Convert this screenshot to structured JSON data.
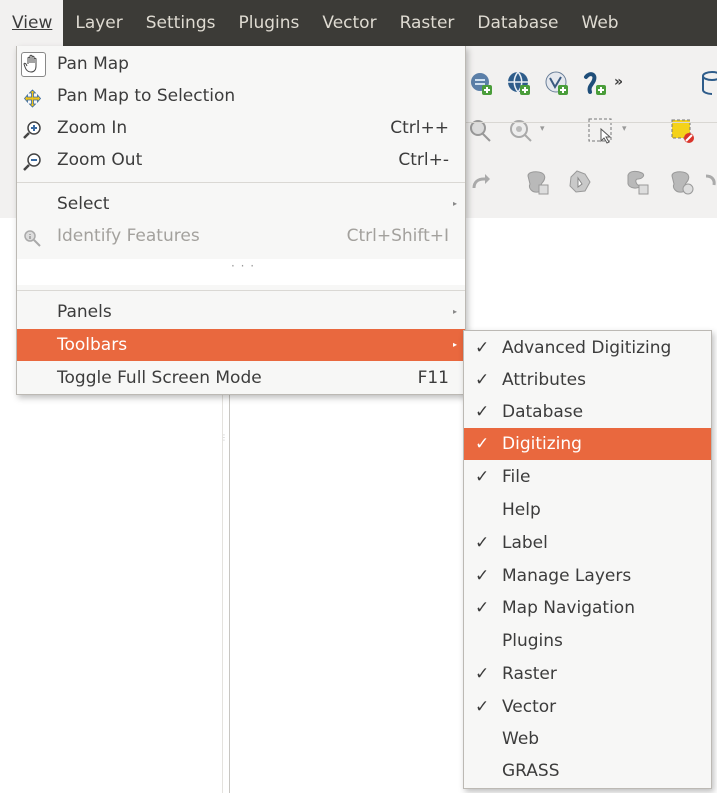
{
  "menubar": {
    "items": [
      {
        "label": "View",
        "underline": "V",
        "active": true
      },
      {
        "label": "Layer",
        "underline": "L"
      },
      {
        "label": "Settings",
        "underline": "S"
      },
      {
        "label": "Plugins",
        "underline": "P"
      },
      {
        "label": "Vector",
        "underline": "o"
      },
      {
        "label": "Raster",
        "underline": "R"
      },
      {
        "label": "Database",
        "underline": "D"
      },
      {
        "label": "Web",
        "underline": "W"
      }
    ]
  },
  "toolbar": {
    "overflow_label": "»"
  },
  "view_menu": {
    "items": [
      {
        "label": "Pan Map",
        "shortcut": "",
        "icon": "pan-hand-icon"
      },
      {
        "label": "Pan Map to Selection",
        "shortcut": "",
        "icon": "pan-to-selection-icon"
      },
      {
        "label": "Zoom In",
        "shortcut": "Ctrl++",
        "icon": "zoom-in-icon"
      },
      {
        "label": "Zoom Out",
        "shortcut": "Ctrl+-",
        "icon": "zoom-out-icon"
      },
      {
        "label": "Select",
        "shortcut": "",
        "submenu": true
      },
      {
        "label": "Identify Features",
        "shortcut": "Ctrl+Shift+I",
        "icon": "identify-icon",
        "disabled": true
      },
      {
        "label": "Panels",
        "shortcut": "",
        "submenu": true
      },
      {
        "label": "Toolbars",
        "shortcut": "",
        "submenu": true,
        "highlighted": true
      },
      {
        "label": "Toggle Full Screen Mode",
        "shortcut": "F11"
      }
    ],
    "tearoff": "· · ·"
  },
  "toolbars_submenu": {
    "items": [
      {
        "label": "Advanced Digitizing",
        "checked": true
      },
      {
        "label": "Attributes",
        "checked": true
      },
      {
        "label": "Database",
        "checked": true
      },
      {
        "label": "Digitizing",
        "checked": true,
        "highlighted": true
      },
      {
        "label": "File",
        "checked": true
      },
      {
        "label": "Help",
        "checked": false
      },
      {
        "label": "Label",
        "checked": true
      },
      {
        "label": "Manage Layers",
        "checked": true
      },
      {
        "label": "Map Navigation",
        "checked": true
      },
      {
        "label": "Plugins",
        "checked": false
      },
      {
        "label": "Raster",
        "checked": true
      },
      {
        "label": "Vector",
        "checked": true
      },
      {
        "label": "Web",
        "checked": false
      },
      {
        "label": "GRASS",
        "checked": false
      }
    ],
    "check_glyph": "✓"
  },
  "colors": {
    "menubar_bg": "#3c3b37",
    "highlight": "#e9683e",
    "menu_bg": "#f7f7f6",
    "disabled_text": "#a3a19d"
  }
}
